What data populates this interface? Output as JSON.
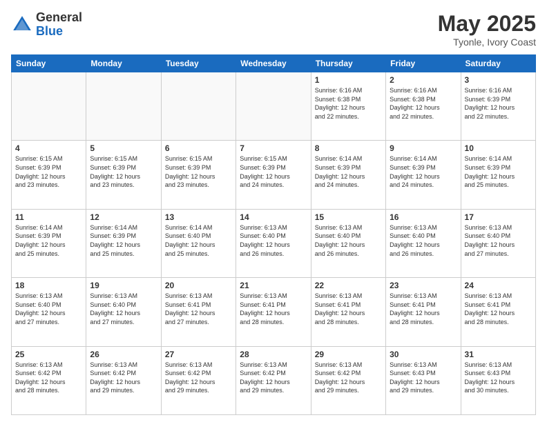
{
  "header": {
    "logo_general": "General",
    "logo_blue": "Blue",
    "month_title": "May 2025",
    "location": "Tyonle, Ivory Coast"
  },
  "days_of_week": [
    "Sunday",
    "Monday",
    "Tuesday",
    "Wednesday",
    "Thursday",
    "Friday",
    "Saturday"
  ],
  "weeks": [
    [
      {
        "day": "",
        "info": ""
      },
      {
        "day": "",
        "info": ""
      },
      {
        "day": "",
        "info": ""
      },
      {
        "day": "",
        "info": ""
      },
      {
        "day": "1",
        "info": "Sunrise: 6:16 AM\nSunset: 6:38 PM\nDaylight: 12 hours\nand 22 minutes."
      },
      {
        "day": "2",
        "info": "Sunrise: 6:16 AM\nSunset: 6:38 PM\nDaylight: 12 hours\nand 22 minutes."
      },
      {
        "day": "3",
        "info": "Sunrise: 6:16 AM\nSunset: 6:39 PM\nDaylight: 12 hours\nand 22 minutes."
      }
    ],
    [
      {
        "day": "4",
        "info": "Sunrise: 6:15 AM\nSunset: 6:39 PM\nDaylight: 12 hours\nand 23 minutes."
      },
      {
        "day": "5",
        "info": "Sunrise: 6:15 AM\nSunset: 6:39 PM\nDaylight: 12 hours\nand 23 minutes."
      },
      {
        "day": "6",
        "info": "Sunrise: 6:15 AM\nSunset: 6:39 PM\nDaylight: 12 hours\nand 23 minutes."
      },
      {
        "day": "7",
        "info": "Sunrise: 6:15 AM\nSunset: 6:39 PM\nDaylight: 12 hours\nand 24 minutes."
      },
      {
        "day": "8",
        "info": "Sunrise: 6:14 AM\nSunset: 6:39 PM\nDaylight: 12 hours\nand 24 minutes."
      },
      {
        "day": "9",
        "info": "Sunrise: 6:14 AM\nSunset: 6:39 PM\nDaylight: 12 hours\nand 24 minutes."
      },
      {
        "day": "10",
        "info": "Sunrise: 6:14 AM\nSunset: 6:39 PM\nDaylight: 12 hours\nand 25 minutes."
      }
    ],
    [
      {
        "day": "11",
        "info": "Sunrise: 6:14 AM\nSunset: 6:39 PM\nDaylight: 12 hours\nand 25 minutes."
      },
      {
        "day": "12",
        "info": "Sunrise: 6:14 AM\nSunset: 6:39 PM\nDaylight: 12 hours\nand 25 minutes."
      },
      {
        "day": "13",
        "info": "Sunrise: 6:14 AM\nSunset: 6:40 PM\nDaylight: 12 hours\nand 25 minutes."
      },
      {
        "day": "14",
        "info": "Sunrise: 6:13 AM\nSunset: 6:40 PM\nDaylight: 12 hours\nand 26 minutes."
      },
      {
        "day": "15",
        "info": "Sunrise: 6:13 AM\nSunset: 6:40 PM\nDaylight: 12 hours\nand 26 minutes."
      },
      {
        "day": "16",
        "info": "Sunrise: 6:13 AM\nSunset: 6:40 PM\nDaylight: 12 hours\nand 26 minutes."
      },
      {
        "day": "17",
        "info": "Sunrise: 6:13 AM\nSunset: 6:40 PM\nDaylight: 12 hours\nand 27 minutes."
      }
    ],
    [
      {
        "day": "18",
        "info": "Sunrise: 6:13 AM\nSunset: 6:40 PM\nDaylight: 12 hours\nand 27 minutes."
      },
      {
        "day": "19",
        "info": "Sunrise: 6:13 AM\nSunset: 6:40 PM\nDaylight: 12 hours\nand 27 minutes."
      },
      {
        "day": "20",
        "info": "Sunrise: 6:13 AM\nSunset: 6:41 PM\nDaylight: 12 hours\nand 27 minutes."
      },
      {
        "day": "21",
        "info": "Sunrise: 6:13 AM\nSunset: 6:41 PM\nDaylight: 12 hours\nand 28 minutes."
      },
      {
        "day": "22",
        "info": "Sunrise: 6:13 AM\nSunset: 6:41 PM\nDaylight: 12 hours\nand 28 minutes."
      },
      {
        "day": "23",
        "info": "Sunrise: 6:13 AM\nSunset: 6:41 PM\nDaylight: 12 hours\nand 28 minutes."
      },
      {
        "day": "24",
        "info": "Sunrise: 6:13 AM\nSunset: 6:41 PM\nDaylight: 12 hours\nand 28 minutes."
      }
    ],
    [
      {
        "day": "25",
        "info": "Sunrise: 6:13 AM\nSunset: 6:42 PM\nDaylight: 12 hours\nand 28 minutes."
      },
      {
        "day": "26",
        "info": "Sunrise: 6:13 AM\nSunset: 6:42 PM\nDaylight: 12 hours\nand 29 minutes."
      },
      {
        "day": "27",
        "info": "Sunrise: 6:13 AM\nSunset: 6:42 PM\nDaylight: 12 hours\nand 29 minutes."
      },
      {
        "day": "28",
        "info": "Sunrise: 6:13 AM\nSunset: 6:42 PM\nDaylight: 12 hours\nand 29 minutes."
      },
      {
        "day": "29",
        "info": "Sunrise: 6:13 AM\nSunset: 6:42 PM\nDaylight: 12 hours\nand 29 minutes."
      },
      {
        "day": "30",
        "info": "Sunrise: 6:13 AM\nSunset: 6:43 PM\nDaylight: 12 hours\nand 29 minutes."
      },
      {
        "day": "31",
        "info": "Sunrise: 6:13 AM\nSunset: 6:43 PM\nDaylight: 12 hours\nand 30 minutes."
      }
    ]
  ]
}
